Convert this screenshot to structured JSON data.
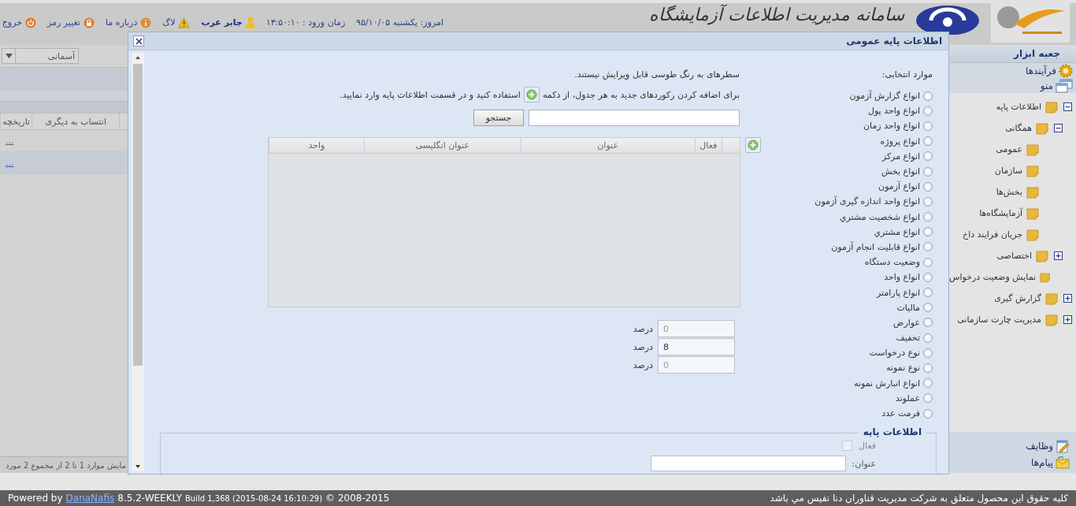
{
  "header": {
    "app_title": "سامانه مدیریت اطلاعات آزمایشگاه",
    "today": "امروز: یکشنبه ۹۵/۱۰/۰۵",
    "login_time": "زمان ورود : ۱۳:۵۰:۱۰",
    "user": "جابر عرب",
    "links": [
      {
        "kind": "log",
        "label": "لاگ"
      },
      {
        "kind": "about",
        "label": "درباره ما"
      },
      {
        "kind": "password",
        "label": "تغییر رمز"
      },
      {
        "kind": "exit",
        "label": "خروج"
      }
    ]
  },
  "left_panel": {
    "dropdown": {
      "value": "آسمانی"
    },
    "table": {
      "columns": [
        "انتساب به دیگری",
        "تاریخچه"
      ],
      "rows": [
        {
          "link": "...",
          "selected": false
        },
        {
          "link": "...",
          "selected": true
        }
      ]
    },
    "status": "مایش موارد 1 تا 2 از مجموع 2 مورد"
  },
  "sidebar": {
    "title": "جعبه ابزار",
    "sections": [
      {
        "kind": "processes",
        "label": "فرآیندها"
      },
      {
        "kind": "menu",
        "label": "منو"
      }
    ],
    "tree": [
      {
        "label": "اطلاعات پایه",
        "expanded": true,
        "children": [
          {
            "label": "همگانی",
            "expanded": true,
            "children": [
              {
                "label": "عمومی"
              },
              {
                "label": "سازمان"
              },
              {
                "label": "بخش‌ها"
              },
              {
                "label": "آزمایشگاه‌ها"
              },
              {
                "label": "جریان فرایند داخ"
              }
            ]
          },
          {
            "label": "اختصاصی",
            "expanded": false
          },
          {
            "label": "نمایش وضعیت درخواس"
          }
        ]
      },
      {
        "label": "گزارش گیری",
        "expanded": false
      },
      {
        "label": "مدیریت چارت سازمانی",
        "expanded": false
      }
    ],
    "bottom": [
      {
        "kind": "tasks",
        "label": "وظایف"
      },
      {
        "kind": "messages",
        "label": "پیام‌ها"
      }
    ]
  },
  "modal": {
    "title": "اطلاعات پایه عمومی",
    "options_heading": "موارد انتخابی:",
    "options": [
      {
        "label": "انواع گزارش آزمون",
        "selected": false
      },
      {
        "label": "انواع واحد پول",
        "selected": false
      },
      {
        "label": "انواع واحد زمان",
        "selected": false
      },
      {
        "label": "انواع پروژه",
        "selected": false
      },
      {
        "label": "انواع مرکز",
        "selected": false
      },
      {
        "label": "انواع بخش",
        "selected": false
      },
      {
        "label": "انواع آزمون",
        "selected": false
      },
      {
        "label": "انواع واحد اندازه گیری آزمون",
        "selected": false
      },
      {
        "label": "انواع شخصیت مشتري",
        "selected": false
      },
      {
        "label": "انواع مشتري",
        "selected": false
      },
      {
        "label": "انواع قابلیت انجام آزمون",
        "selected": false
      },
      {
        "label": "وضعیت دستگاه",
        "selected": false
      },
      {
        "label": "انواع واحد",
        "selected": false
      },
      {
        "label": "انواع پارامتر",
        "selected": false
      },
      {
        "label": "مالیات",
        "selected": false
      },
      {
        "label": "عوارض",
        "selected": false
      },
      {
        "label": "تخفیف",
        "selected": false
      },
      {
        "label": "نوع درخواست",
        "selected": false
      },
      {
        "label": "نوع نمونه",
        "selected": false
      },
      {
        "label": "انواع انبارش نمونه",
        "selected": false
      },
      {
        "label": "عملوند",
        "selected": false
      },
      {
        "label": "فرمت عدد",
        "selected": false
      }
    ],
    "notes": {
      "readonly": "سطرهای به رنگ طوسی قابل ویرایش نیستند.",
      "add_before": "برای اضافه کردن رکوردهای جدید به هر جدول، از دکمه",
      "add_after": "استفاده کنید و در قسمت اطلاعات پایه وارد نمایید."
    },
    "search": {
      "button": "جستجو"
    },
    "grid": {
      "columns": [
        "فعال",
        "عنوان",
        "عنوان انگلیسی",
        "واحد"
      ]
    },
    "percent_fields": [
      {
        "placeholder": "0",
        "unit": "درصد"
      },
      {
        "value": "8",
        "unit": "درصد"
      },
      {
        "placeholder": "0",
        "unit": "درصد"
      }
    ],
    "base_info": {
      "legend": "اطلاعات پایه",
      "active": {
        "label": "فعال",
        "checked": false,
        "disabled": true
      },
      "title_label": "عنوان:"
    }
  },
  "footer": {
    "powered": "Powered by",
    "brand": "DanaNafis",
    "version": "8.5.2-WEEKLY",
    "build": "Build 1,368 (2015-08-24 16:10:29)",
    "copyright": "© 2008-2015",
    "rights": "کلیه حقوق این محصول متعلق به شرکت مدیریت فناوران دنا نفیس مي باشد"
  }
}
